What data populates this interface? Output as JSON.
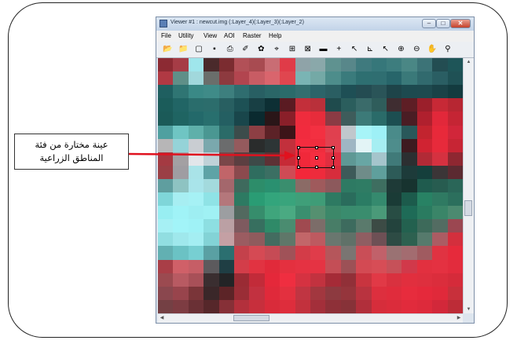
{
  "callout": {
    "line1": "عينة مختارة من فئة",
    "line2": "المناطق الزراعية"
  },
  "viewer": {
    "title": "Viewer #1 : newcut.img (:Layer_4)(:Layer_3)(:Layer_2)",
    "menu": [
      "File",
      "Utility",
      "View",
      "AOI",
      "Raster",
      "Help"
    ],
    "tools": [
      {
        "name": "open-folder-icon",
        "glyph": "📂"
      },
      {
        "name": "open-layer-icon",
        "glyph": "📁"
      },
      {
        "name": "new-viewer-icon",
        "glyph": "▢"
      },
      {
        "name": "save-icon",
        "glyph": "▪"
      },
      {
        "name": "print-icon",
        "glyph": "⎙"
      },
      {
        "name": "eraser-icon",
        "glyph": "✐"
      },
      {
        "name": "color-wheel-icon",
        "glyph": "✿"
      },
      {
        "name": "inquire-icon",
        "glyph": "⌖"
      },
      {
        "name": "fit-window-icon",
        "glyph": "⊞"
      },
      {
        "name": "expand-icon",
        "glyph": "⊠"
      },
      {
        "name": "line-tool-icon",
        "glyph": "▬"
      },
      {
        "name": "crosshair-icon",
        "glyph": "+"
      },
      {
        "name": "pointer-tool-icon",
        "glyph": "↖"
      },
      {
        "name": "chart-icon",
        "glyph": "⊾"
      },
      {
        "name": "select-arrow-icon",
        "glyph": "↖"
      },
      {
        "name": "zoom-in-icon",
        "glyph": "⊕"
      },
      {
        "name": "zoom-out-icon",
        "glyph": "⊖"
      },
      {
        "name": "pan-hand-icon",
        "glyph": "✋"
      },
      {
        "name": "tool-pin-icon",
        "glyph": "⚲"
      }
    ]
  },
  "image": {
    "rows": [
      [
        "#8c2a33",
        "#a63c46",
        "#9fe6ec",
        "#4a2a2b",
        "#7b2c30",
        "#b25057",
        "#a84b51",
        "#c96d74",
        "#e03b48",
        "#8fa3a8",
        "#8aa8aa",
        "#5f9290",
        "#58878a",
        "#3f7a7e",
        "#36777a",
        "#3d7d7e",
        "#4a8785",
        "#3c7377",
        "#234d52",
        "#1e5558"
      ],
      [
        "#b03943",
        "#5f8f88",
        "#a1d8dc",
        "#6a6e6b",
        "#8d3a3f",
        "#b2454f",
        "#c85c64",
        "#d9656d",
        "#e0464f",
        "#7ab4b4",
        "#74a9a6",
        "#4d8d8b",
        "#3a7b7c",
        "#2e6f71",
        "#2f6e71",
        "#27656a",
        "#3a7979",
        "#316a6e",
        "#2a5e63",
        "#1f5155"
      ],
      [
        "#1f5f60",
        "#2f7573",
        "#3a8986",
        "#3f8b88",
        "#3d7f7e",
        "#2f6d6f",
        "#285f63",
        "#2a6667",
        "#2b6b6a",
        "#336e6f",
        "#2c6469",
        "#2a5e62",
        "#1e4f55",
        "#244c52",
        "#2a5458",
        "#1e4449",
        "#1d4a4f",
        "#1e4a4f",
        "#1a4247",
        "#133b3f"
      ],
      [
        "#1b5c5a",
        "#216565",
        "#2a6d6c",
        "#2c6d6c",
        "#285f61",
        "#1d5155",
        "#183f44",
        "#0d2f34",
        "#5a1b22",
        "#c32f3a",
        "#b9303a",
        "#1f4b4d",
        "#2b5e5d",
        "#3a6b6a",
        "#2f5d5b",
        "#3f2d31",
        "#5e1e25",
        "#9b1f2b",
        "#c72936",
        "#b72632"
      ],
      [
        "#1b5a58",
        "#1f6462",
        "#23696a",
        "#286f6e",
        "#245f62",
        "#19464b",
        "#0a2a2f",
        "#2a1618",
        "#8a1f29",
        "#ef2c3d",
        "#e72c3b",
        "#8b3b44",
        "#3e5c5b",
        "#3c7a78",
        "#2a6b69",
        "#1c4e51",
        "#4a1d24",
        "#b0202e",
        "#e2283a",
        "#c52534"
      ],
      [
        "#4fa0a0",
        "#6fc5c3",
        "#5fb0aa",
        "#4a9792",
        "#2b6b68",
        "#3c4c4b",
        "#8d3f44",
        "#5c2227",
        "#3d1418",
        "#f12b3e",
        "#f33041",
        "#e0404f",
        "#c0c7cc",
        "#a7f4f8",
        "#9ef0f6",
        "#4a8b8a",
        "#29585a",
        "#c2242f",
        "#e8293a",
        "#d1263a"
      ],
      [
        "#b7b6b7",
        "#95d3d8",
        "#c9cdd2",
        "#7aa8ad",
        "#6b6c6d",
        "#955a5d",
        "#2a2c2c",
        "#2d3536",
        "#c2303c",
        "#f42c3f",
        "#f02d3e",
        "#e04150",
        "#9fb6c4",
        "#e3f4f6",
        "#a6eef2",
        "#4e8d8c",
        "#3e1b20",
        "#d02332",
        "#e72a3b",
        "#c72534"
      ],
      [
        "#a43a42",
        "#a3a0a3",
        "#e2e6ea",
        "#bfd2d8",
        "#7a4749",
        "#5c3f41",
        "#3d4a48",
        "#5d3135",
        "#c72a37",
        "#f1283a",
        "#f52e40",
        "#e02e40",
        "#5e9895",
        "#68a6a4",
        "#a5c5cc",
        "#407a79",
        "#2c2f31",
        "#b12a36",
        "#d53140",
        "#8e2731"
      ],
      [
        "#9b3f45",
        "#9f9da2",
        "#a9e3e8",
        "#5ea3a6",
        "#c16569",
        "#8b4a4e",
        "#2f6d5f",
        "#3b6f63",
        "#cf4b55",
        "#f3273a",
        "#ee2b3c",
        "#d72d3c",
        "#3d5a59",
        "#6f8c89",
        "#5f9f9c",
        "#2d5b58",
        "#1d3b3a",
        "#153f3c",
        "#3b3537",
        "#5b2a31"
      ],
      [
        "#5f9e9f",
        "#8ec3c2",
        "#a9e4ea",
        "#a3dadd",
        "#a4676c",
        "#3e6a5d",
        "#2d8d6a",
        "#2a9070",
        "#3a8e6e",
        "#8b6b66",
        "#9f5a5c",
        "#8c595c",
        "#2e7a63",
        "#2f7c64",
        "#3e6e60",
        "#1e3a37",
        "#17332f",
        "#1f5b4e",
        "#275c50",
        "#2a6658"
      ],
      [
        "#7fd6d9",
        "#a7eef2",
        "#a6f1f5",
        "#8fe3e6",
        "#b4777b",
        "#2d7a62",
        "#2a9c74",
        "#33a57c",
        "#39a47c",
        "#3f9f79",
        "#3f9c77",
        "#2e7a62",
        "#2a6c5c",
        "#2b7c64",
        "#358a6e",
        "#1a3b36",
        "#1c5b4c",
        "#288264",
        "#2f7a62",
        "#2c6f5d"
      ],
      [
        "#98eef2",
        "#a0f3f7",
        "#9eeef2",
        "#a0f1f4",
        "#9c9ea1",
        "#52695f",
        "#368d6c",
        "#3fa57c",
        "#4aaa82",
        "#3a8f6f",
        "#559070",
        "#3c8869",
        "#3a8c6e",
        "#3a8d6e",
        "#4a9a79",
        "#284d44",
        "#1e6b57",
        "#2a7b60",
        "#3a8568",
        "#4c8a70"
      ],
      [
        "#a6f0f4",
        "#a2f4f8",
        "#9ff2f6",
        "#8ddfe2",
        "#bba0a4",
        "#7e5a5f",
        "#376f5f",
        "#2f8a68",
        "#4a8c70",
        "#a04a50",
        "#7c6d69",
        "#487d67",
        "#3d6b5e",
        "#5a7a6c",
        "#3c4b45",
        "#23433d",
        "#23614f",
        "#3d6a5a",
        "#536c62",
        "#9b4751"
      ],
      [
        "#91dee1",
        "#9fe8ec",
        "#a4eef2",
        "#83d3d6",
        "#c4a0a4",
        "#9b5c61",
        "#8f5b5d",
        "#436c60",
        "#5f7769",
        "#c26669",
        "#bd5a60",
        "#6a776f",
        "#607168",
        "#8f5e62",
        "#6e5055",
        "#2d4b44",
        "#2d6150",
        "#567a6c",
        "#ab5c63",
        "#d42f3d"
      ],
      [
        "#62b0b2",
        "#6bc2c4",
        "#77cfd2",
        "#5aa0a3",
        "#2b6f70",
        "#c4414b",
        "#d54a54",
        "#c64b55",
        "#a05258",
        "#d33c48",
        "#e03c4a",
        "#b5565b",
        "#7a7572",
        "#c94e57",
        "#c1616a",
        "#9a7273",
        "#a36c70",
        "#a05b60",
        "#e03342",
        "#e62a3b"
      ],
      [
        "#a93e47",
        "#d06068",
        "#c65e66",
        "#5c5a5d",
        "#1f3e44",
        "#d33d49",
        "#e13341",
        "#e12a3a",
        "#e4303f",
        "#e53242",
        "#e53343",
        "#c44e56",
        "#9c5156",
        "#d34a53",
        "#d74d56",
        "#c65159",
        "#d1394a",
        "#e2303f",
        "#e43141",
        "#e22c3d"
      ],
      [
        "#9b4a50",
        "#b85a62",
        "#a85058",
        "#3a2e30",
        "#232426",
        "#9a2b34",
        "#c22b39",
        "#e5283a",
        "#ef2e40",
        "#d53241",
        "#c2323f",
        "#a52b37",
        "#913038",
        "#c9343f",
        "#e13946",
        "#d9313f",
        "#e12f3e",
        "#de2f3e",
        "#db2d3c",
        "#d52b3a"
      ],
      [
        "#8a474e",
        "#98444c",
        "#7a3539",
        "#3a2729",
        "#5c2427",
        "#9a2d36",
        "#c23140",
        "#e0293a",
        "#e3303f",
        "#c03542",
        "#a2373f",
        "#8d3a40",
        "#95353c",
        "#b9333f",
        "#dd2f3e",
        "#e02c3c",
        "#e72c3d",
        "#e5293b",
        "#e0293a",
        "#c8303b"
      ],
      [
        "#744044",
        "#7d3c42",
        "#6a3035",
        "#56272a",
        "#863037",
        "#b3303c",
        "#c72f3c",
        "#d92b3a",
        "#de2d3c",
        "#c2313d",
        "#a32f3a",
        "#8e3038",
        "#873238",
        "#b12f3b",
        "#d62d3b",
        "#db2c3b",
        "#e12b3c",
        "#dd2a3b",
        "#d2283a",
        "#bd2c37"
      ]
    ]
  }
}
